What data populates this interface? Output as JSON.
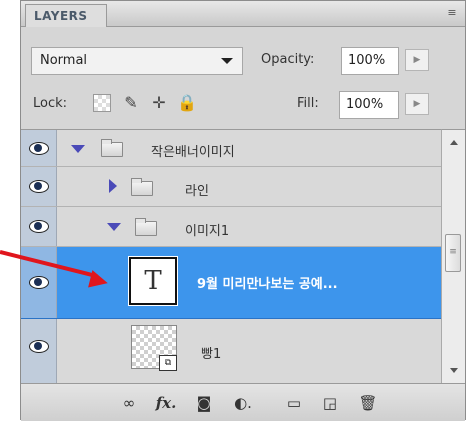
{
  "panel": {
    "tab_label": "LAYERS",
    "menu_icon": "panel-menu-icon"
  },
  "blend": {
    "mode": "Normal",
    "opacity_label": "Opacity:",
    "opacity_value": "100%"
  },
  "lock": {
    "label": "Lock:",
    "fill_label": "Fill:",
    "fill_value": "100%",
    "icons": [
      "lock-transparent-icon",
      "lock-paint-icon",
      "lock-move-icon",
      "lock-all-icon"
    ]
  },
  "layers": [
    {
      "name": "작은배너이미지",
      "type": "group",
      "expanded": true,
      "visible": true
    },
    {
      "name": "라인",
      "type": "group",
      "expanded": false,
      "visible": false
    },
    {
      "name": "이미지1",
      "type": "group",
      "expanded": true,
      "visible": true
    },
    {
      "name": "9월 미리만나보는 공예...",
      "type": "text",
      "visible": true,
      "selected": true,
      "thumb_glyph": "T"
    },
    {
      "name": "빵1",
      "type": "smart-object",
      "visible": true
    }
  ],
  "toolbar": {
    "icons": [
      "link-icon",
      "fx-icon",
      "mask-icon",
      "adjustment-icon",
      "new-group-icon",
      "new-layer-icon",
      "trash-icon"
    ],
    "fx_label": "fx."
  },
  "colors": {
    "selection": "#3d95ec",
    "annotation_arrow": "#e0161d"
  }
}
